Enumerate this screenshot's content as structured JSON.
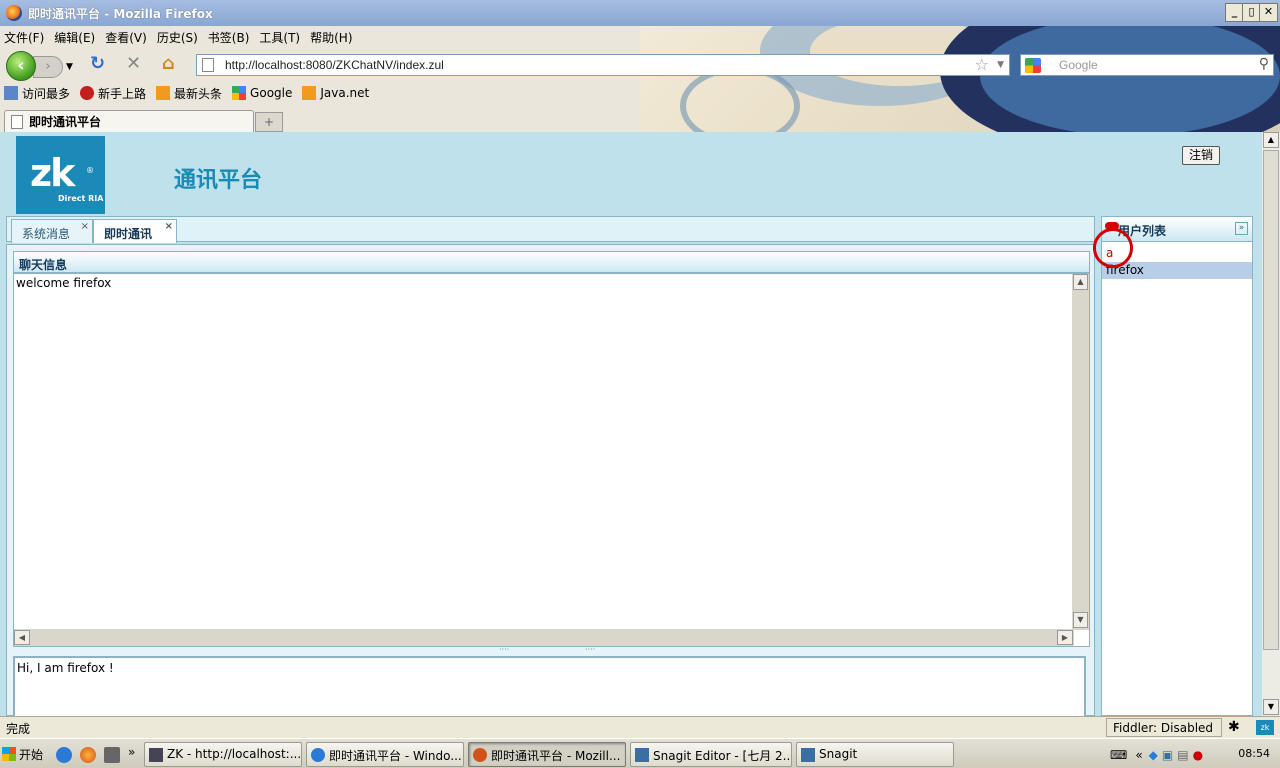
{
  "window": {
    "title": "即时通讯平台 - Mozilla Firefox",
    "min": "_",
    "max": "▯",
    "close": "✕"
  },
  "menubar": [
    "文件(F)",
    "编辑(E)",
    "查看(V)",
    "历史(S)",
    "书签(B)",
    "工具(T)",
    "帮助(H)"
  ],
  "nav": {
    "url": "http://localhost:8080/ZKChatNV/index.zul",
    "search_placeholder": "Google"
  },
  "bookmarks": [
    "访问最多",
    "新手上路",
    "最新头条",
    "Google",
    "Java.net"
  ],
  "browser_tab": {
    "title": "即时通讯平台",
    "new_tab": "+"
  },
  "app": {
    "logo_text": "zk",
    "logo_sub": "Direct RIA",
    "logo_reg": "®",
    "title": "通讯平台",
    "logout": "注销",
    "tabs": [
      {
        "label": "系统消息",
        "close": "×"
      },
      {
        "label": "即时通讯",
        "close": "×"
      }
    ],
    "chat": {
      "header": "聊天信息",
      "messages": [
        "welcome firefox"
      ],
      "input_value": "Hi, I am firefox !",
      "splitter": "⁘⁘⁘⁘⁘⁘⁘⁘⁘⁘⁘⁘⁘⁘⁘⁘⁘⁘⁘⁘⁘⁘⁘⁘⁘⁘⁘⁘⁘⁘⁘⁘⁘⁘⁘⁘⁘⁘⁘⁘⁘⁘⁘⁘⁘⁘⁘⁘⁘"
    },
    "users": {
      "header": "用户列表",
      "collapse": "»",
      "items": [
        {
          "name": "a"
        },
        {
          "name": "firefox",
          "selected": true
        }
      ]
    }
  },
  "statusbar": {
    "status": "完成",
    "fiddler": "Fiddler: Disabled"
  },
  "taskbar": {
    "start": "开始",
    "tasks": [
      {
        "label": "ZK - http://localhost:..."
      },
      {
        "label": "即时通讯平台 - Windo..."
      },
      {
        "label": "即时通讯平台 - Mozill..."
      },
      {
        "label": "Snagit Editor - [七月 2..."
      },
      {
        "label": "Snagit"
      }
    ],
    "clock": "08:54"
  }
}
